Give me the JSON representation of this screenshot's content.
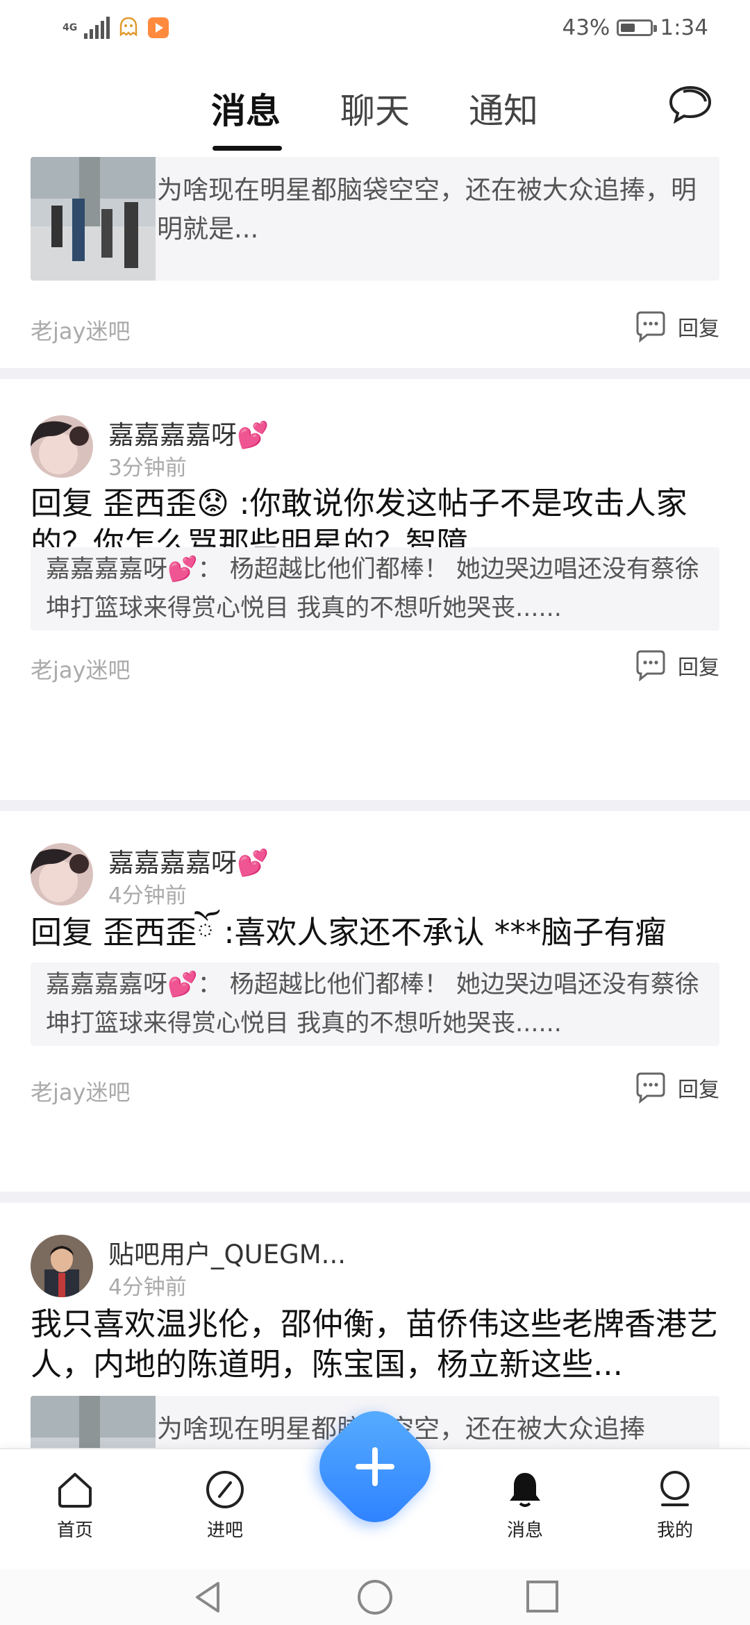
{
  "status_bar": {
    "network": "4G",
    "battery_percent": "43%",
    "battery_level": 0.43,
    "time": "1:34"
  },
  "tabs": [
    {
      "label": "消息",
      "active": true
    },
    {
      "label": "聊天",
      "active": false
    },
    {
      "label": "通知",
      "active": false
    }
  ],
  "posts": [
    {
      "partial": true,
      "quote": "为啥现在明星都脑袋空空，还在被大众追捧，明明就是...",
      "forum": "老jay迷吧",
      "reply_label": "回复"
    },
    {
      "user": "嘉嘉嘉嘉呀",
      "time": "3分钟前",
      "content": "回复 歪西歪😟 :你敢说你发这帖子不是攻击人家的？你怎么骂那些明星的？智障",
      "quote": "嘉嘉嘉嘉呀💕：  杨超越比他们都棒！  她边哭边唱还没有蔡徐坤打篮球来得赏心悦目 我真的不想听她哭丧......",
      "forum": "老jay迷吧",
      "reply_label": "回复"
    },
    {
      "user": "嘉嘉嘉嘉呀",
      "time": "4分钟前",
      "content": "回复 歪西歪ོ :喜欢人家还不承认 ***脑子有瘤",
      "quote": "嘉嘉嘉嘉呀💕：  杨超越比他们都棒！  她边哭边唱还没有蔡徐坤打篮球来得赏心悦目 我真的不想听她哭丧......",
      "forum": "老jay迷吧",
      "reply_label": "回复"
    },
    {
      "user": "贴吧用户_QUEGM...",
      "time": "4分钟前",
      "content": "我只喜欢温兆伦，邵仲衡，苗侨伟这些老牌香港艺人，内地的陈道明，陈宝国，杨立新这些...",
      "quote": "为啥现在明星都脑袋空空，还在被大众追捧"
    }
  ],
  "bottom_nav": [
    {
      "label": "首页",
      "icon": "home-icon"
    },
    {
      "label": "进吧",
      "icon": "compass-icon"
    },
    {
      "label": "消息",
      "icon": "bell-icon",
      "active": true
    },
    {
      "label": "我的",
      "icon": "profile-icon"
    }
  ],
  "colors": {
    "accent": "#2b7eff",
    "quote_bg": "#f5f4f7",
    "divider": "#f1f1f5"
  }
}
